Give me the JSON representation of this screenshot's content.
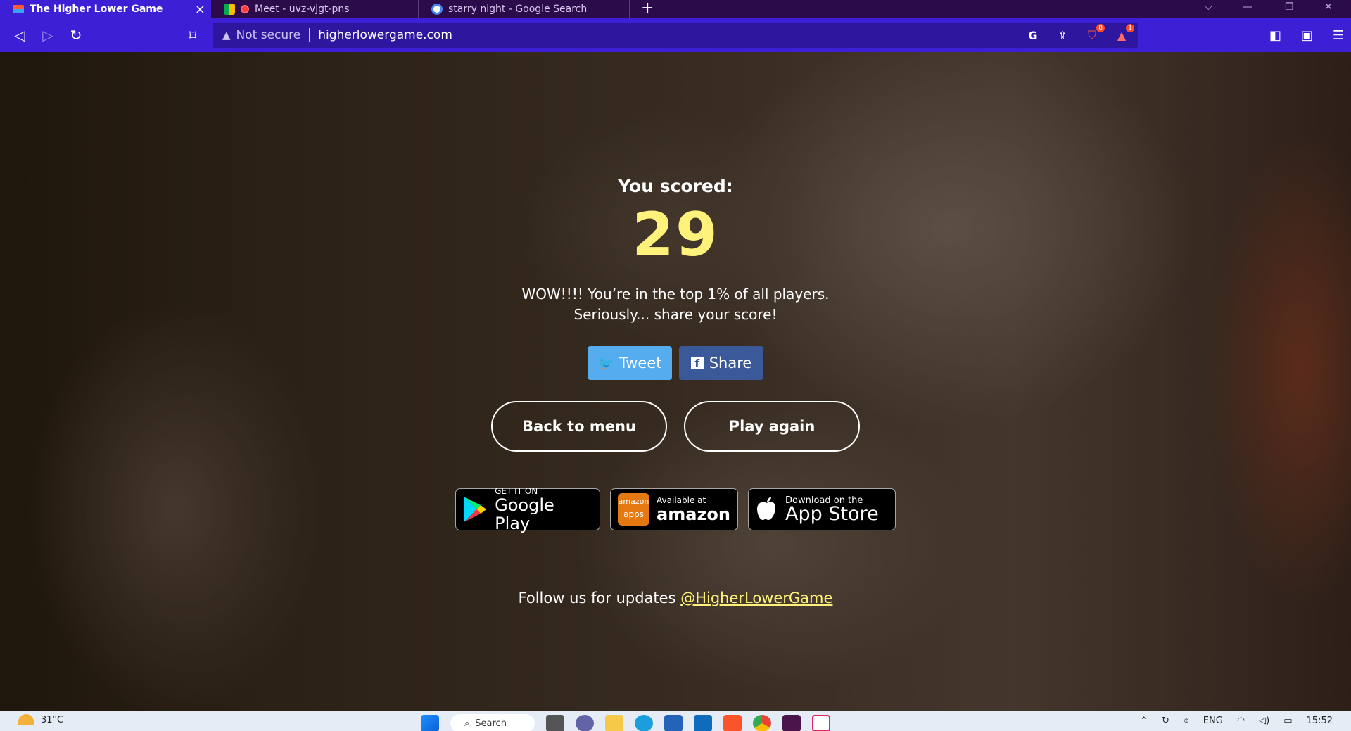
{
  "browser": {
    "tabs": [
      {
        "label": "The Higher Lower Game",
        "active": true
      },
      {
        "label": "Meet - uvz-vjgt-pns",
        "active": false
      },
      {
        "label": "starry night - Google Search",
        "active": false
      }
    ],
    "new_tab": "+",
    "close_tab": "×",
    "security_label": "Not secure",
    "url": "higherlowergame.com",
    "shields_badge": "8",
    "alerts_badge": "1",
    "accent_color": "#3d1fd6"
  },
  "game": {
    "scored_label": "You scored:",
    "score": "29",
    "message_line1": "WOW!!!! You’re in the top 1% of all players.",
    "message_line2": "Seriously... share your score!",
    "tweet_label": "Tweet",
    "share_label": "Share",
    "back_label": "Back to menu",
    "play_again_label": "Play again",
    "google_play_small": "GET IT ON",
    "google_play_big": "Google Play",
    "amazon_small": "Available at",
    "amazon_big": "amazon",
    "amazon_logo_top": "amazon",
    "amazon_logo_bottom": "apps",
    "appstore_small": "Download on the",
    "appstore_big": "App Store",
    "follow_text": "Follow us for updates ",
    "follow_handle": "@HigherLowerGame",
    "score_color": "#fff27a"
  },
  "taskbar": {
    "temperature": "31°C",
    "search_label": "Search",
    "language": "ENG",
    "time": "15:52"
  }
}
